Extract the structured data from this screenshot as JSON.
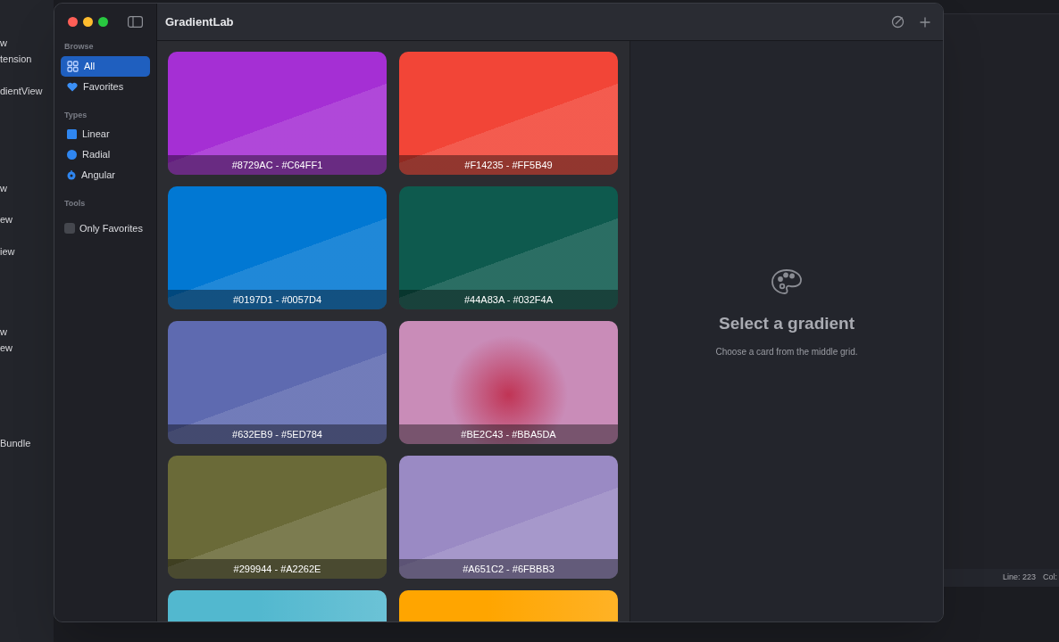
{
  "background_editor": {
    "sidebar_fragments": [
      "w",
      "tension",
      "dientView",
      "w",
      "ew",
      "iew",
      "w",
      "ew",
      "Bundle"
    ],
    "status_bar": {
      "line": "Line: 223",
      "col": "Col:"
    }
  },
  "window": {
    "title": "GradientLab"
  },
  "sidebar": {
    "sections": [
      {
        "title": "Browse",
        "items": [
          {
            "label": "All",
            "selected": true
          },
          {
            "label": "Favorites",
            "selected": false
          }
        ]
      },
      {
        "title": "Types",
        "items": [
          {
            "label": "Linear",
            "selected": false
          },
          {
            "label": "Radial",
            "selected": false
          },
          {
            "label": "Angular",
            "selected": false
          }
        ]
      },
      {
        "title": "Tools",
        "checkbox": {
          "label": "Only Favorites",
          "checked": false
        }
      }
    ]
  },
  "cards": [
    {
      "kind": "angular",
      "color": "#a52fd4",
      "label": "#8729AC - #C64FF1"
    },
    {
      "kind": "angular",
      "color": "#f24537",
      "label": "#F14235 - #FF5B49"
    },
    {
      "kind": "angular",
      "color": "#0178d3",
      "label": "#0197D1 - #0057D4"
    },
    {
      "kind": "angular",
      "color": "#0e5a4e",
      "label": "#44A83A - #032F4A"
    },
    {
      "kind": "angular",
      "color": "#5e6ab0",
      "label": "#632EB9 - #5ED784"
    },
    {
      "kind": "radial",
      "color": "#c98cb8",
      "label": "#BE2C43 - #BBA5DA"
    },
    {
      "kind": "angular",
      "color": "#6a6a38",
      "label": "#299944 - #A2262E"
    },
    {
      "kind": "angular",
      "color": "#9a8ac4",
      "label": "#A651C2 - #6FBBB3"
    },
    {
      "kind": "linear",
      "color": "#52b8cf"
    },
    {
      "kind": "linear",
      "color": "#ffa500"
    }
  ],
  "detail": {
    "title": "Select a gradient",
    "subtitle": "Choose a card from the middle grid."
  }
}
